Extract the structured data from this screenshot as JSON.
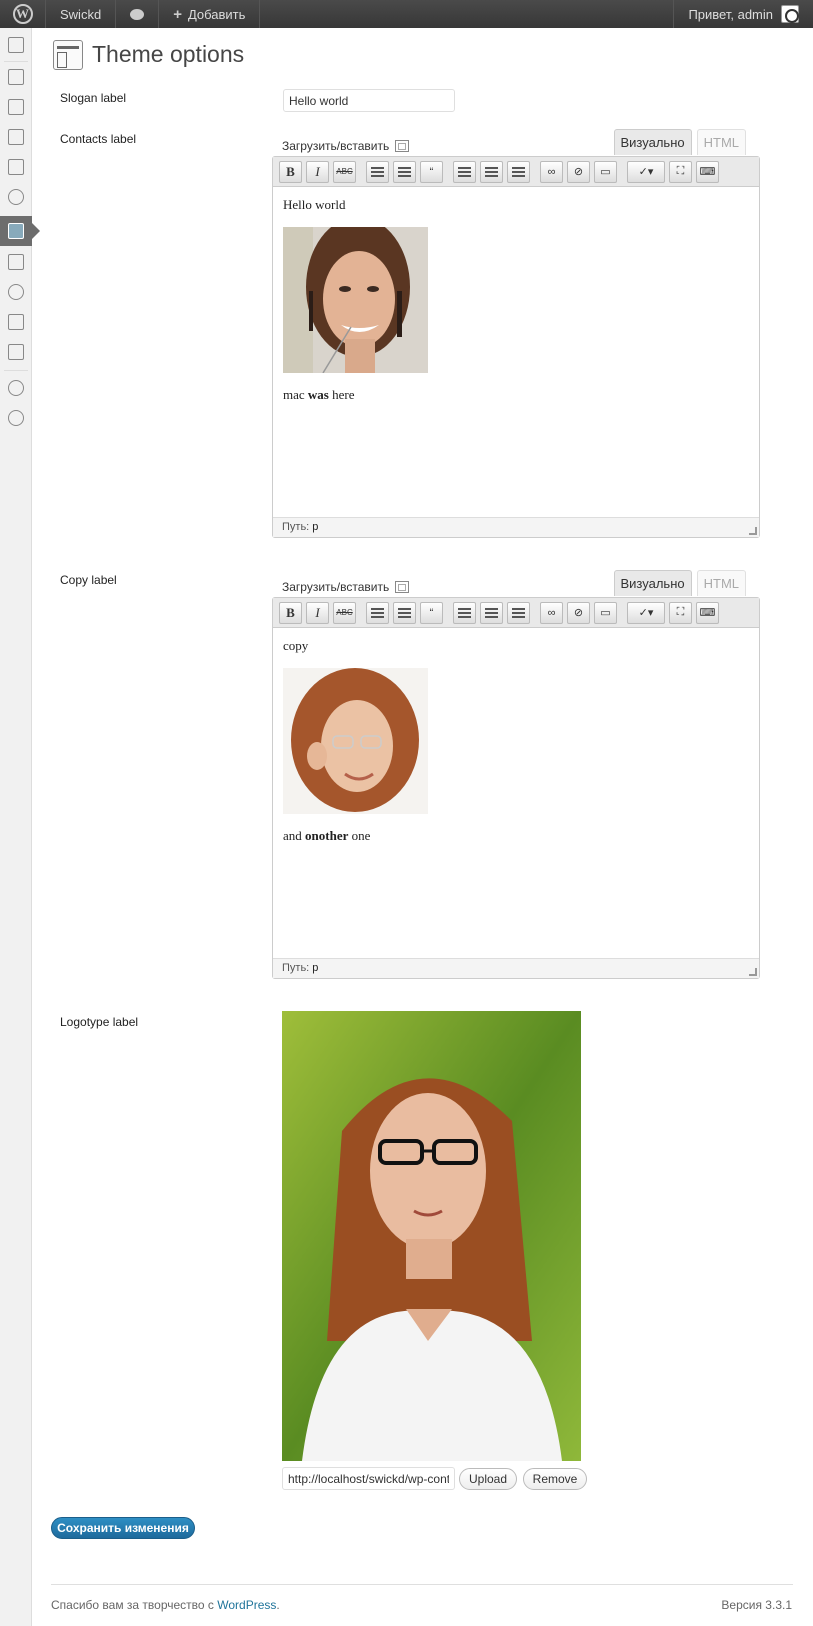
{
  "adminbar": {
    "site_name": "Swickd",
    "add_new": "Добавить",
    "greeting": "Привет, admin"
  },
  "page": {
    "title": "Theme options"
  },
  "fields": {
    "slogan": {
      "label": "Slogan label",
      "value": "Hello world"
    },
    "contacts": {
      "label": "Contacts label",
      "media_label": "Загрузить/вставить",
      "tab_visual": "Визуально",
      "tab_html": "HTML",
      "content": {
        "line1": "Hello world",
        "line2_a": "mac ",
        "line2_b": "was",
        "line2_c": " here"
      },
      "path_label": "Путь:",
      "path_value": "p"
    },
    "copy": {
      "label": "Copy label",
      "media_label": "Загрузить/вставить",
      "tab_visual": "Визуально",
      "tab_html": "HTML",
      "content": {
        "line1": "copy",
        "line2_a": "and ",
        "line2_b": "onother",
        "line2_c": " one"
      },
      "path_label": "Путь:",
      "path_value": "p"
    },
    "logotype": {
      "label": "Logotype label",
      "url_value": "http://localhost/swickd/wp-content",
      "upload_label": "Upload",
      "remove_label": "Remove"
    }
  },
  "actions": {
    "save_label": "Сохранить изменения"
  },
  "footer": {
    "thanks_prefix": "Спасибо вам за творчество с ",
    "thanks_link": "WordPress",
    "thanks_suffix": ".",
    "version": "Версия 3.3.1"
  },
  "icons": [
    "wordpress-logo-icon",
    "comment-icon",
    "plus-icon",
    "avatar-icon",
    "media-upload-icon",
    "resize-handle-icon"
  ]
}
